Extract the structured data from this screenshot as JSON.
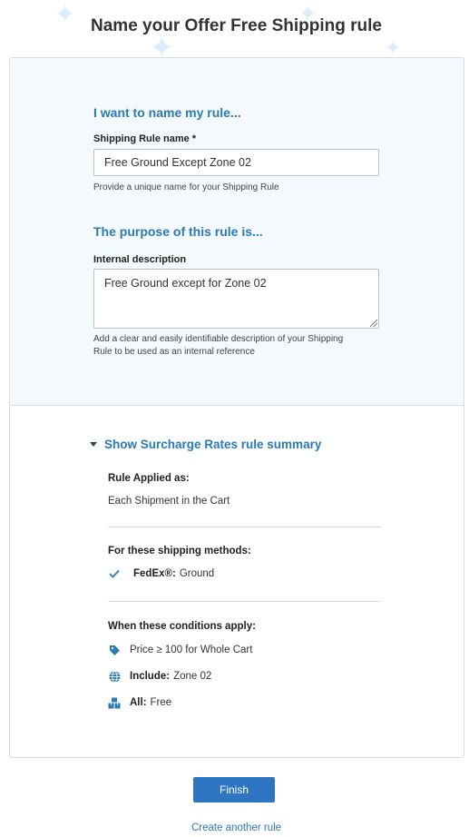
{
  "header": {
    "title_prefix": "Name your",
    "title_bold": "Offer Free Shipping rule"
  },
  "name_section": {
    "heading": "I want to name my rule...",
    "label": "Shipping Rule name *",
    "value": "Free Ground Except Zone 02",
    "help": "Provide a unique name for your Shipping Rule"
  },
  "purpose_section": {
    "heading": "The purpose of this rule is...",
    "label": "Internal description",
    "value": "Free Ground except for Zone 02",
    "help_line1": "Add a clear and easily identifiable description of your Shipping",
    "help_line2": "Rule to be used as an internal reference"
  },
  "summary": {
    "toggle_label": "Show Surcharge Rates rule summary",
    "applied_label": "Rule Applied as:",
    "applied_value": "Each Shipment in the Cart",
    "methods_label": "For these shipping methods:",
    "method_carrier": "FedEx®:",
    "method_service": "Ground",
    "conditions_label": "When these conditions apply:",
    "condition_price": "Price ≥ 100 for Whole Cart",
    "condition_include_label": "Include:",
    "condition_include_value": "Zone 02",
    "condition_all_label": "All:",
    "condition_all_value": "Free"
  },
  "actions": {
    "finish_label": "Finish",
    "create_another_label": "Create another rule"
  },
  "colors": {
    "accent": "#2b7ab8",
    "button": "#2f76c2",
    "panel_bg": "#f4f9fd"
  },
  "icons": [
    "sparkle-icon",
    "check-icon",
    "tag-icon",
    "globe-icon",
    "boxes-icon",
    "caret-down-icon"
  ]
}
